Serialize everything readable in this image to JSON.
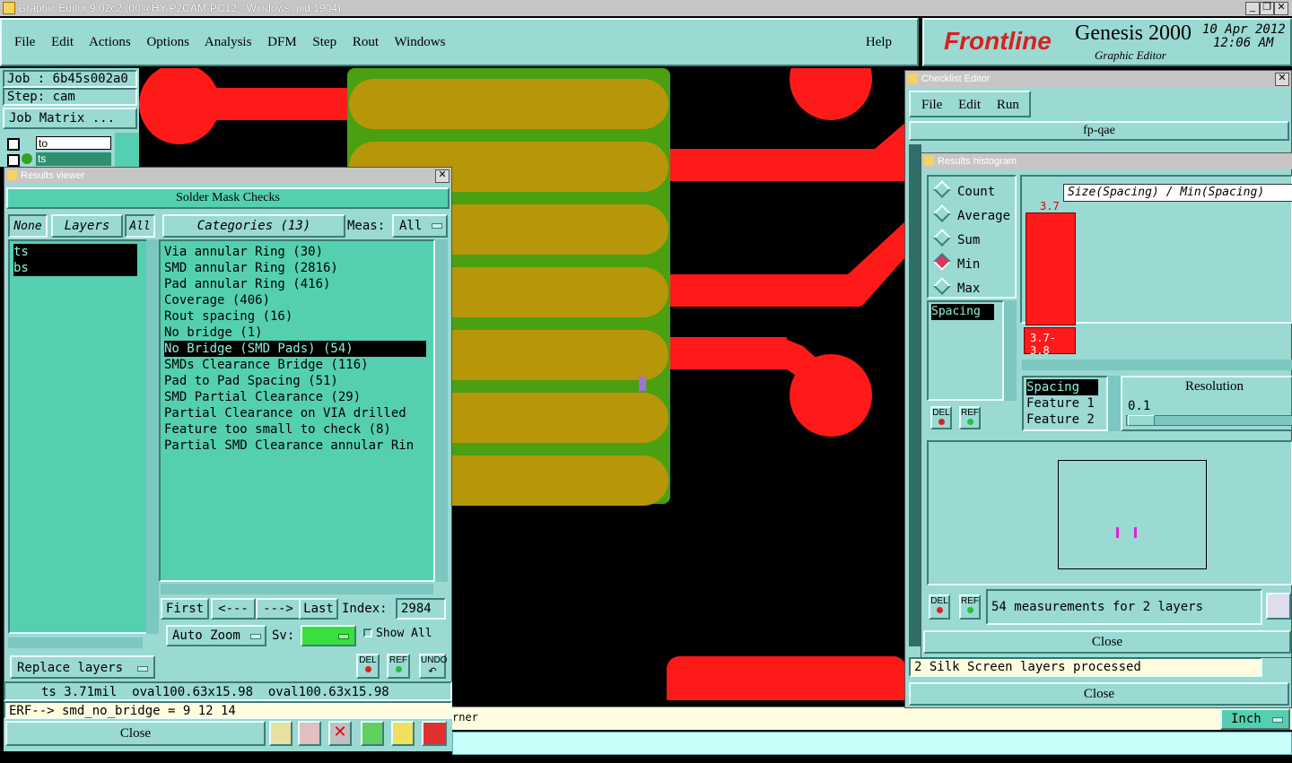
{
  "window": {
    "title": "Graphic Editor 9.02c2 (00@HY-P2CAM-PC12 - Windows, pid:1904)"
  },
  "menu": {
    "items": [
      "File",
      "Edit",
      "Actions",
      "Options",
      "Analysis",
      "DFM",
      "Step",
      "Rout",
      "Windows"
    ],
    "help": "Help"
  },
  "brand": {
    "logo": "Frontline",
    "product": "Genesis 2000",
    "subtitle": "Graphic Editor",
    "date": "10 Apr 2012",
    "time": "12:06 AM"
  },
  "job": {
    "job_label": "Job : 6b45s002a0",
    "step_label": "Step: cam",
    "matrix_btn": "Job Matrix ...",
    "layer1": "to",
    "layer2": "ts"
  },
  "results_viewer": {
    "title": "Results viewer",
    "header": "Solder Mask Checks",
    "none": "None",
    "layers": "Layers",
    "all": "All",
    "categories_btn": "Categories (13)",
    "meas_label": "Meas:",
    "meas_value": "All",
    "layer_list": [
      "ts",
      "bs"
    ],
    "categories": [
      "Via annular Ring (30)",
      "SMD annular Ring (2816)",
      "Pad annular Ring (416)",
      "Coverage (406)",
      "Rout spacing (16)",
      "No bridge (1)",
      "No Bridge (SMD Pads) (54)",
      "SMDs Clearance Bridge (116)",
      "Pad to Pad Spacing (51)",
      "SMD Partial Clearance (29)",
      "Partial Clearance on VIA drilled",
      "Feature too small to check (8)",
      "Partial SMD Clearance annular Rin"
    ],
    "selected_index": 6,
    "nav": {
      "first": "First",
      "prev": "<---",
      "next": "--->",
      "last": "Last",
      "index_label": "Index:",
      "index_value": "2984"
    },
    "auto_zoom": "Auto Zoom",
    "sv": "Sv:",
    "show_all": "Show All",
    "replace_layers": "Replace layers",
    "del": "DEL",
    "ref": "REF",
    "undo": "UNDO",
    "status": "ts 3.71mil  oval100.63x15.98  oval100.63x15.98",
    "erf": "ERF--> smd_no_bridge = 9 12 14",
    "close": "Close"
  },
  "checklist": {
    "title": "Checklist Editor",
    "menu": [
      "File",
      "Edit",
      "Run"
    ],
    "name": "fp-qae",
    "status": "2 Silk Screen layers processed",
    "close": "Close"
  },
  "histogram": {
    "title": "Results histogram",
    "options": [
      "Count",
      "Average",
      "Sum",
      "Min",
      "Max"
    ],
    "selected": "Min",
    "list": [
      "Spacing"
    ],
    "chart_label": "Size(Spacing) / Min(Spacing)",
    "bar_value": "3.7",
    "bar_range": "3.7-3.8",
    "fields": [
      "Spacing",
      "Feature 1",
      "Feature 2"
    ],
    "resolution_label": "Resolution",
    "resolution_value": "0.1",
    "del": "DEL",
    "ref": "REF",
    "measurements": "54 measurements for 2 layers",
    "close": "Close"
  },
  "bottom": {
    "corner_text": "rner",
    "unit": "Inch"
  },
  "colors": {
    "teal": "#9bd9d3",
    "green": "#54d0b0",
    "copper_red": "#ff1a1a",
    "smd_gold": "#b8960a",
    "mask_green": "#4aa010"
  }
}
